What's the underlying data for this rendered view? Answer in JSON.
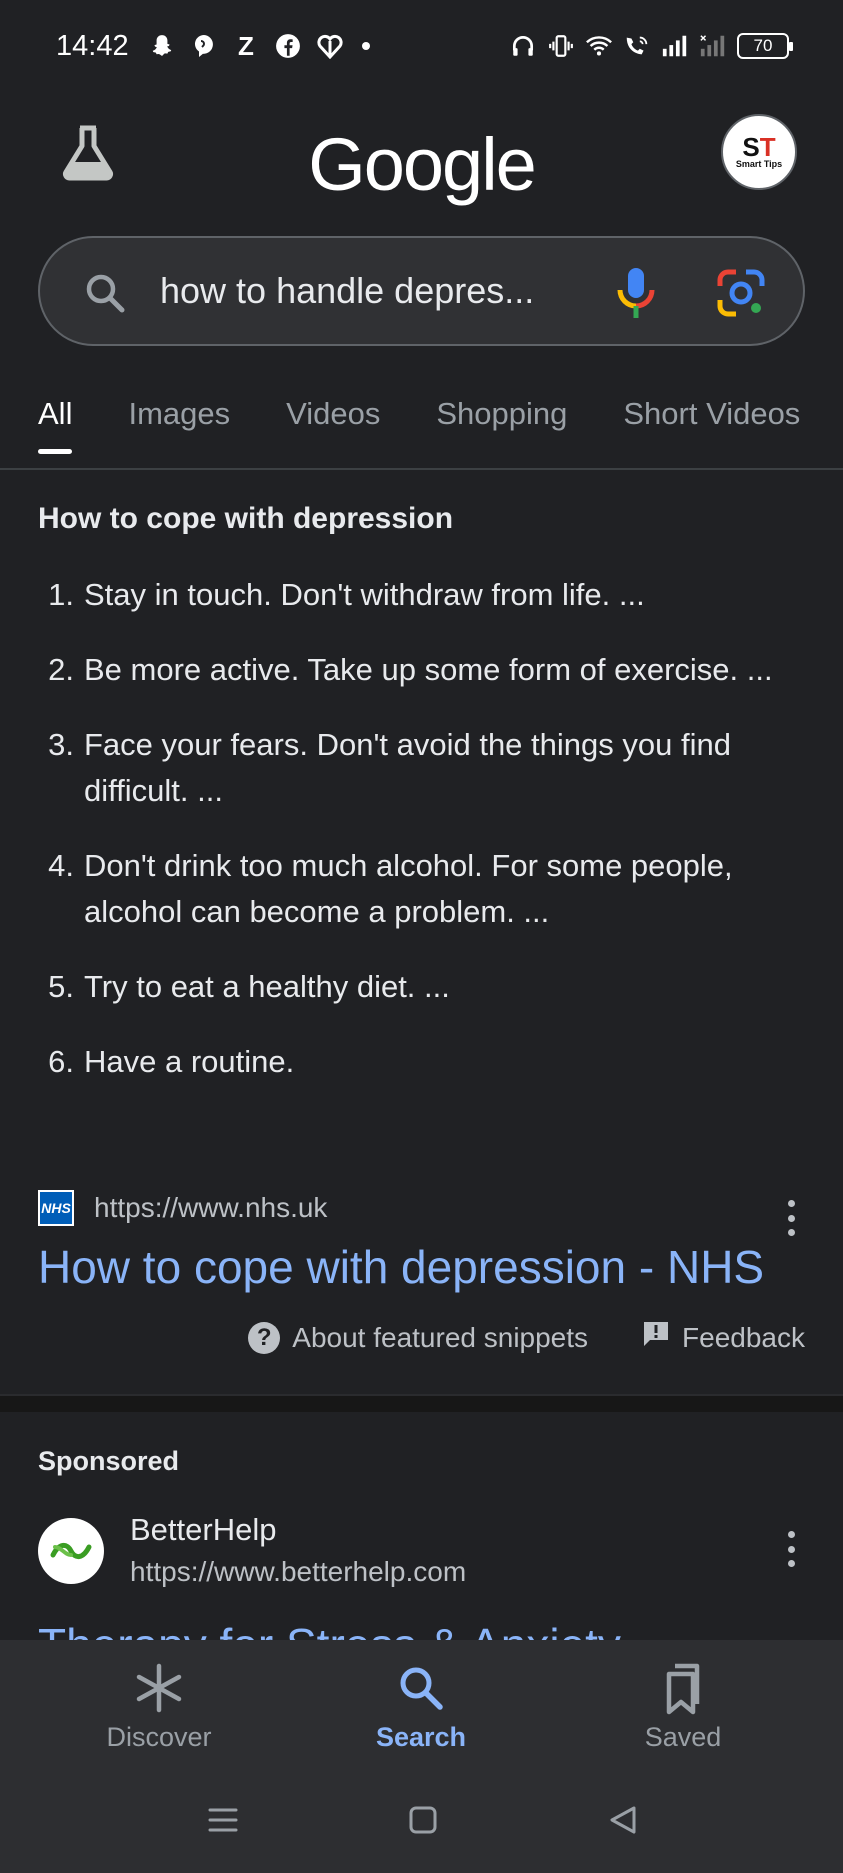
{
  "status_bar": {
    "time": "14:42",
    "left_icons": [
      "snapchat-icon",
      "messenger-icon",
      "zomato-icon",
      "facebook-icon",
      "heart-app-icon",
      "dot-indicator"
    ],
    "right_icons": [
      "headphones-icon",
      "vibrate-icon",
      "wifi-icon",
      "wifi-calling-icon",
      "signal-icon",
      "signal-weak-icon"
    ],
    "battery": "70"
  },
  "header": {
    "logo": "Google",
    "labs_icon": "flask-icon",
    "avatar": {
      "mono": "ST",
      "sub": "Smart Tips"
    }
  },
  "search": {
    "query": "how to handle depres..."
  },
  "tabs": [
    {
      "label": "All",
      "active": true
    },
    {
      "label": "Images",
      "active": false
    },
    {
      "label": "Videos",
      "active": false
    },
    {
      "label": "Shopping",
      "active": false
    },
    {
      "label": "Short Videos",
      "active": false
    }
  ],
  "snippet": {
    "title": "How to cope with depression",
    "items": [
      {
        "num": "1.",
        "text": "Stay in touch. Don't withdraw from life. ..."
      },
      {
        "num": "2.",
        "text": "Be more active. Take up some form of exercise. ..."
      },
      {
        "num": "3.",
        "text": "Face your fears. Don't avoid the things you find difficult. ..."
      },
      {
        "num": "4.",
        "text": "Don't drink too much alcohol. For some people, alcohol can become a problem. ..."
      },
      {
        "num": "5.",
        "text": "Try to eat a healthy diet. ..."
      },
      {
        "num": "6.",
        "text": "Have a routine."
      }
    ],
    "source_favicon": "NHS",
    "source_url": "https://www.nhs.uk",
    "link": "How to cope with depression - NHS",
    "about": "About featured snippets",
    "feedback": "Feedback"
  },
  "sponsored": {
    "label": "Sponsored",
    "name": "BetterHelp",
    "url": "https://www.betterhelp.com",
    "peek_title": "Therapy for Stress & Anxiety"
  },
  "bottom_nav": [
    {
      "label": "Discover",
      "icon": "asterisk-icon",
      "active": false
    },
    {
      "label": "Search",
      "icon": "search-icon",
      "active": true
    },
    {
      "label": "Saved",
      "icon": "bookmarks-icon",
      "active": false
    }
  ],
  "colors": {
    "background": "#202124",
    "link": "#8ab4f8",
    "nav_bg": "#2d2e31"
  }
}
